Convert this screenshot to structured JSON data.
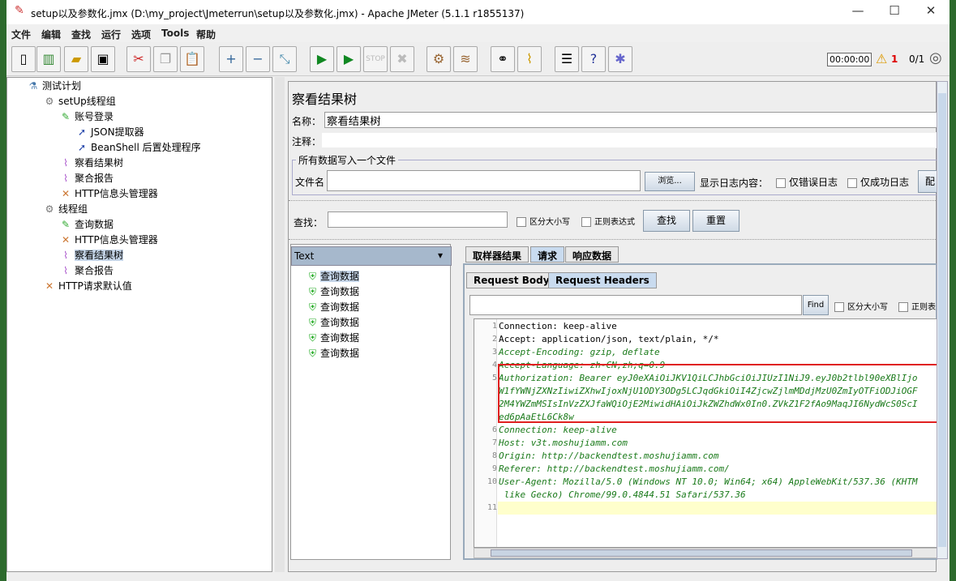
{
  "window": {
    "title": "setup以及参数化.jmx (D:\\my_project\\Jmeterrun\\setup以及参数化.jmx) - Apache JMeter (5.1.1 r1855137)"
  },
  "menu": [
    "文件",
    "编辑",
    "查找",
    "运行",
    "选项",
    "Tools",
    "帮助"
  ],
  "toolbar": {
    "timer": "00:00:00",
    "warnings": "1",
    "threads": "0/1"
  },
  "tree": [
    {
      "label": "测试计划",
      "level": 0,
      "icon": "test-plan-icon"
    },
    {
      "label": "setUp线程组",
      "level": 1,
      "icon": "gear-icon"
    },
    {
      "label": "账号登录",
      "level": 2,
      "icon": "pipette-icon"
    },
    {
      "label": "JSON提取器",
      "level": 3,
      "icon": "extractor-icon"
    },
    {
      "label": "BeanShell 后置处理程序",
      "level": 3,
      "icon": "extractor-icon"
    },
    {
      "label": "察看结果树",
      "level": 2,
      "icon": "chart-icon"
    },
    {
      "label": "聚合报告",
      "level": 2,
      "icon": "chart-icon"
    },
    {
      "label": "HTTP信息头管理器",
      "level": 2,
      "icon": "tools-icon"
    },
    {
      "label": "线程组",
      "level": 1,
      "icon": "gear-icon"
    },
    {
      "label": "查询数据",
      "level": 2,
      "icon": "pipette-icon"
    },
    {
      "label": "HTTP信息头管理器",
      "level": 2,
      "icon": "tools-icon"
    },
    {
      "label": "察看结果树",
      "level": 2,
      "icon": "chart-icon",
      "selected": true
    },
    {
      "label": "聚合报告",
      "level": 2,
      "icon": "chart-icon"
    },
    {
      "label": "HTTP请求默认值",
      "level": 1,
      "icon": "tools-icon"
    }
  ],
  "panel": {
    "title": "察看结果树",
    "name_label": "名称：",
    "name_value": "察看结果树",
    "comment_label": "注释：",
    "file_group": "所有数据写入一个文件",
    "file_label": "文件名",
    "browse": "浏览...",
    "log_label": "显示日志内容：",
    "errors_only": "仅错误日志",
    "success_only": "仅成功日志",
    "config": "配",
    "search_label": "查找：",
    "case_sensitive": "区分大小写",
    "regex": "正则表达式",
    "search_btn": "查找",
    "reset_btn": "重置",
    "renderer": "Text",
    "results": [
      "查询数据",
      "查询数据",
      "查询数据",
      "查询数据",
      "查询数据",
      "查询数据"
    ],
    "tabs": [
      "取样器结果",
      "请求",
      "响应数据"
    ],
    "subtabs": [
      "Request Body",
      "Request Headers"
    ],
    "find_btn": "Find",
    "find_case": "区分大小写",
    "find_regex": "正则表"
  },
  "code_lines": [
    {
      "n": "1",
      "text": "Connection: keep-alive",
      "style": "plain"
    },
    {
      "n": "2",
      "text": "Accept: application/json, text/plain, */*",
      "style": "plain"
    },
    {
      "n": "3",
      "text": "Accept-Encoding: gzip, deflate",
      "style": "green"
    },
    {
      "n": "4",
      "text": "Accept-Language: zh-CN,zh;q=0.9",
      "style": "green"
    },
    {
      "n": "5",
      "text": "Authorization: Bearer eyJ0eXAiOiJKV1QiLCJhbGciOiJIUzI1NiJ9.eyJ0b2tlbl90eXBlIjo",
      "style": "green"
    },
    {
      "n": "",
      "text": "W1fYWNjZXNzIiwiZXhwIjoxNjU1ODY3ODg5LCJqdGkiOiI4ZjcwZjlmMDdjMzU0ZmIyOTFiODJiOGF",
      "style": "green"
    },
    {
      "n": "",
      "text": "2M4YWZmMSIsInVzZXJfaWQiOjE2MiwidHAiOiJkZWZhdWx0In0.ZVkZ1F2fAo9MaqJI6NydWcS0ScI",
      "style": "green"
    },
    {
      "n": "",
      "text": "ed6pAaEtL6Ck8w",
      "style": "green"
    },
    {
      "n": "6",
      "text": "Connection: keep-alive",
      "style": "green"
    },
    {
      "n": "7",
      "text": "Host: v3t.moshujiamm.com",
      "style": "green"
    },
    {
      "n": "8",
      "text": "Origin: http://backendtest.moshujiamm.com",
      "style": "green"
    },
    {
      "n": "9",
      "text": "Referer: http://backendtest.moshujiamm.com/",
      "style": "green"
    },
    {
      "n": "10",
      "text": "User-Agent: Mozilla/5.0 (Windows NT 10.0; Win64; x64) AppleWebKit/537.36 (KHTM",
      "style": "green"
    },
    {
      "n": "",
      "text": " like Gecko) Chrome/99.0.4844.51 Safari/537.36",
      "style": "green"
    },
    {
      "n": "11",
      "text": "",
      "style": "plain"
    }
  ],
  "colors": {
    "highlight_box": "#e02020",
    "code_green": "#1a7a1a",
    "current_line": "#ffffcc"
  }
}
